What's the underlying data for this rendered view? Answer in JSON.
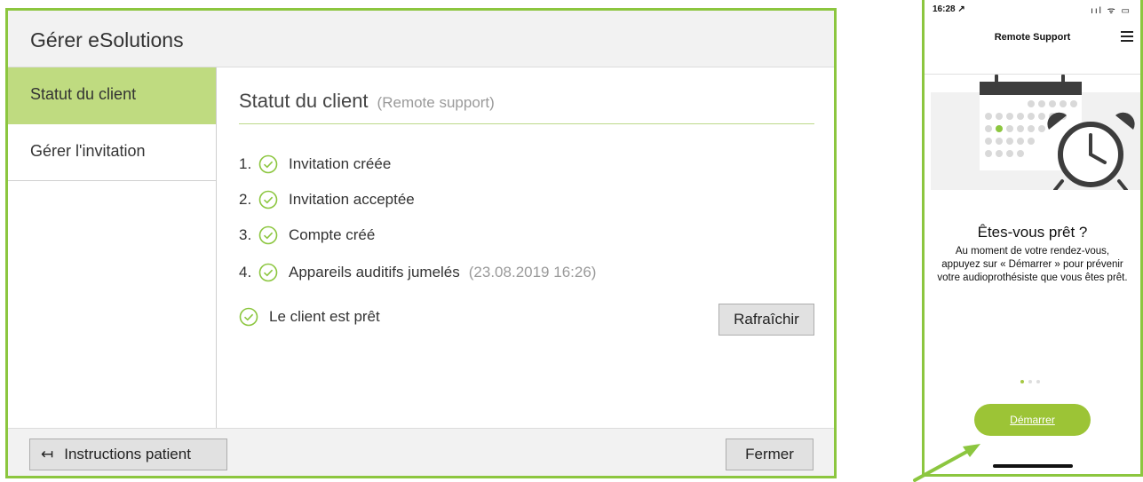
{
  "dialog": {
    "title": "Gérer eSolutions",
    "sidebar": {
      "items": [
        {
          "label": "Statut du client"
        },
        {
          "label": "Gérer l'invitation"
        }
      ]
    },
    "content": {
      "heading": "Statut du client",
      "heading_sub": "(Remote support)",
      "steps": [
        {
          "num": "1.",
          "label": "Invitation créée",
          "date": ""
        },
        {
          "num": "2.",
          "label": "Invitation acceptée",
          "date": ""
        },
        {
          "num": "3.",
          "label": "Compte créé",
          "date": ""
        },
        {
          "num": "4.",
          "label": "Appareils auditifs jumelés",
          "date": "(23.08.2019 16:26)"
        }
      ],
      "ready_text": "Le client est prêt",
      "refresh_label": "Rafraîchir"
    },
    "footer": {
      "instructions_icon": "↤",
      "instructions_label": "Instructions patient",
      "close_label": "Fermer"
    }
  },
  "phone": {
    "status_time": "16:28 ↗",
    "status_icons": "ııl ᯤ ▭",
    "nav_title": "Remote Support",
    "title": "Êtes-vous prêt ?",
    "text": "Au moment de votre rendez-vous, appuyez sur « Démarrer » pour prévenir votre audioprothésiste que vous êtes prêt.",
    "start_label": "Démarrer",
    "page_indicator": {
      "count": 3,
      "active": 1
    }
  },
  "colors": {
    "accent_green": "#8cc63f",
    "sidebar_active": "#bfdb80",
    "button_green": "#9cc436"
  },
  "icons": {
    "step_check": "check-circle-icon",
    "instructions": "arrow-left-to-bar-icon",
    "menu": "hamburger-menu-icon",
    "illustration": "calendar-alarm-clock-illustration"
  }
}
